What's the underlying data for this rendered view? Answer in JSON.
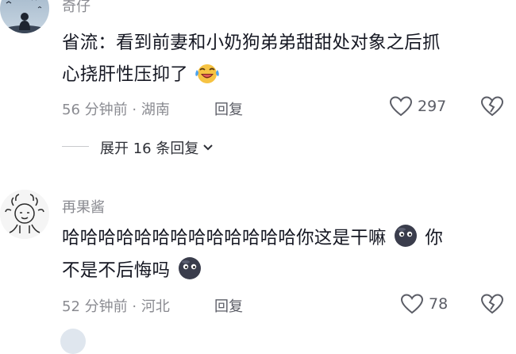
{
  "comment1": {
    "username": "奇仔",
    "text_line1": "省流：看到前妻和小奶狗弟弟甜甜处对象之后抓",
    "text_line2": "心挠肝性压抑了",
    "time": "56 分钟前",
    "location": "湖南",
    "reply_label": "回复",
    "like_count": "297",
    "avatar": "night-sky-with-birds-avatar"
  },
  "expand": {
    "label": "展开 16 条回复",
    "icon": "chevron-down-icon"
  },
  "comment2": {
    "username": "再果酱",
    "text_line1": "哈哈哈哈哈哈哈哈哈哈哈哈哈你这是干嘛",
    "text_line2_tail": "你",
    "text_line2": "不是不后悔吗",
    "time": "52 分钟前",
    "location": "河北",
    "reply_label": "回复",
    "like_count": "78",
    "avatar": "sketch-character-avatar"
  },
  "icons": {
    "like": "heart-outline-icon",
    "dislike": "broken-heart-icon",
    "emoji_laugh": "laughing-tears-emoji",
    "emoji_face": "dark-blob-face-emoji"
  },
  "colors": {
    "text_primary": "#161823",
    "text_secondary": "#8a8b91",
    "text_action": "#5b5d66"
  }
}
